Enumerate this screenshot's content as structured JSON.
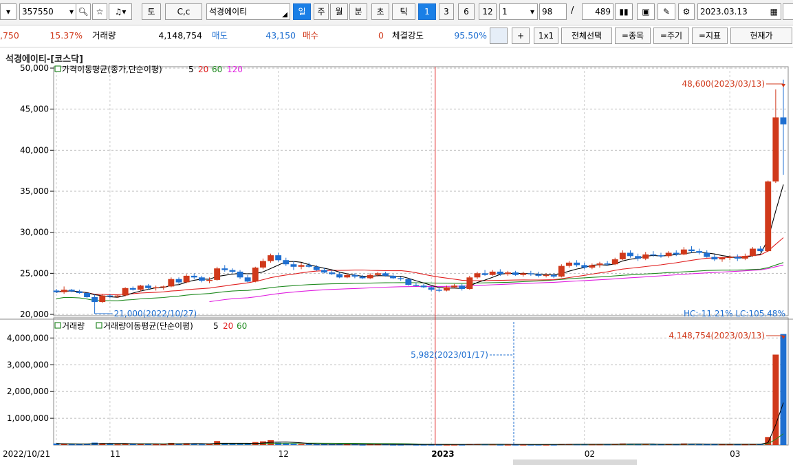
{
  "toolbar": {
    "code": "357550",
    "btn_to": "토",
    "btn_cc": "C,c",
    "stock_name": "석경에이티",
    "period_day": "일",
    "period_week": "주",
    "period_month": "월",
    "period_minute": "분",
    "period_second": "초",
    "period_tick": "틱",
    "n1": "1",
    "n3": "3",
    "n6": "6",
    "n12": "12",
    "interval_select": "1",
    "count_value": "98",
    "slash": "/",
    "total_value": "489",
    "date_value": "2023.03.13"
  },
  "infobar": {
    "change": ",750",
    "change_pct": "15.37%",
    "volume_label": "거래량",
    "volume_value": "4,148,754",
    "sell_label": "매도",
    "sell_value": "43,150",
    "buy_label": "매수",
    "buy_value": "0",
    "strength_label": "체결강도",
    "strength_value": "95.50%",
    "btn_plus": "+",
    "btn_1x1": "1x1",
    "btn_select_all": "전체선택",
    "btn_item": "=종목",
    "btn_period": "=주기",
    "btn_indicator": "=지표",
    "btn_current": "현재가"
  },
  "chart_title": "석경에이티-[코스닥]",
  "colors": {
    "up": "#d0391b",
    "down": "#1f6fd0",
    "ma5": "#000000",
    "ma20": "#e02020",
    "ma60": "#1f8a1f",
    "ma120": "#e020e0",
    "crosshair": "#e02020",
    "annot_blue": "#1f6fd0"
  },
  "chart_data": [
    {
      "type": "candlestick",
      "legend": {
        "label": "가격이동평균(종가,단순이평)",
        "periods": [
          "5",
          "20",
          "60",
          "120"
        ]
      },
      "ylim": [
        20000,
        50000
      ],
      "yticks": [
        "50,000",
        "45,000",
        "40,000",
        "35,000",
        "30,000",
        "25,000",
        "20,000"
      ],
      "ytick_values": [
        50000,
        45000,
        40000,
        35000,
        30000,
        25000,
        20000
      ],
      "annotations": {
        "high": "48,600(2023/03/13)",
        "low": "21,000(2022/10/27)",
        "hc_lc": "HC:-11.21%  LC:105.48%"
      },
      "candles": [
        [
          22900,
          23100,
          22600,
          22700
        ],
        [
          22700,
          23400,
          22500,
          23000
        ],
        [
          23000,
          23100,
          22700,
          22800
        ],
        [
          22800,
          23000,
          22500,
          22600
        ],
        [
          22600,
          22700,
          22000,
          22100
        ],
        [
          22100,
          22400,
          21000,
          21500
        ],
        [
          21500,
          22500,
          21400,
          22300
        ],
        [
          22300,
          22500,
          22000,
          22200
        ],
        [
          22200,
          22400,
          22000,
          22300
        ],
        [
          22300,
          23300,
          22200,
          23200
        ],
        [
          23200,
          23400,
          22900,
          23000
        ],
        [
          23000,
          23600,
          22800,
          23500
        ],
        [
          23500,
          23700,
          23000,
          23200
        ],
        [
          23200,
          23500,
          22900,
          23300
        ],
        [
          23300,
          23500,
          23000,
          23400
        ],
        [
          23400,
          24500,
          23300,
          24300
        ],
        [
          24300,
          24500,
          23700,
          23900
        ],
        [
          23900,
          24900,
          23800,
          24700
        ],
        [
          24700,
          25000,
          24300,
          24500
        ],
        [
          24500,
          24700,
          23900,
          24100
        ],
        [
          24100,
          24500,
          23800,
          24200
        ],
        [
          24200,
          25800,
          24100,
          25600
        ],
        [
          25600,
          26000,
          25200,
          25400
        ],
        [
          25400,
          25600,
          25000,
          25200
        ],
        [
          25200,
          25400,
          24300,
          24500
        ],
        [
          24500,
          24800,
          23900,
          24000
        ],
        [
          24000,
          25800,
          23900,
          25700
        ],
        [
          25700,
          26800,
          25500,
          26500
        ],
        [
          26500,
          27400,
          26300,
          27200
        ],
        [
          27200,
          27500,
          26400,
          26600
        ],
        [
          26600,
          26900,
          25900,
          26100
        ],
        [
          26100,
          26500,
          25400,
          25800
        ],
        [
          25800,
          26300,
          25500,
          26000
        ],
        [
          26000,
          26300,
          25700,
          25800
        ],
        [
          25800,
          26000,
          25300,
          25400
        ],
        [
          25400,
          25700,
          25000,
          25100
        ],
        [
          25100,
          25400,
          24800,
          24900
        ],
        [
          24900,
          25100,
          24400,
          24500
        ],
        [
          24500,
          25000,
          24400,
          24800
        ],
        [
          24800,
          25000,
          24400,
          24600
        ],
        [
          24600,
          24800,
          24300,
          24400
        ],
        [
          24400,
          25000,
          24300,
          24800
        ],
        [
          24800,
          25200,
          24600,
          25000
        ],
        [
          25000,
          25200,
          24600,
          24700
        ],
        [
          24700,
          24900,
          24300,
          24400
        ],
        [
          24400,
          24600,
          24100,
          24300
        ],
        [
          24300,
          24400,
          23500,
          23600
        ],
        [
          23600,
          23900,
          23400,
          23500
        ],
        [
          23500,
          23700,
          23200,
          23300
        ],
        [
          23300,
          23400,
          22800,
          23000
        ],
        [
          23000,
          23200,
          22700,
          22900
        ],
        [
          22900,
          23500,
          22800,
          23300
        ],
        [
          23300,
          23700,
          23200,
          23500
        ],
        [
          23500,
          23700,
          22900,
          23100
        ],
        [
          23100,
          24700,
          23000,
          24500
        ],
        [
          24500,
          25200,
          24300,
          25000
        ],
        [
          25000,
          25400,
          24700,
          24800
        ],
        [
          24800,
          25400,
          24700,
          25200
        ],
        [
          25200,
          25500,
          24700,
          24900
        ],
        [
          24900,
          25300,
          24700,
          25100
        ],
        [
          25100,
          25300,
          24700,
          24800
        ],
        [
          24800,
          25200,
          24600,
          25000
        ],
        [
          25000,
          25300,
          24700,
          24900
        ],
        [
          24900,
          25200,
          24500,
          24700
        ],
        [
          24700,
          25000,
          24500,
          24800
        ],
        [
          24800,
          25000,
          24400,
          24600
        ],
        [
          24600,
          26100,
          24500,
          25900
        ],
        [
          25900,
          26500,
          25700,
          26300
        ],
        [
          26300,
          26600,
          25800,
          26000
        ],
        [
          26000,
          26300,
          25500,
          25700
        ],
        [
          25700,
          26200,
          25500,
          26000
        ],
        [
          26000,
          26400,
          25700,
          26200
        ],
        [
          26200,
          26500,
          25900,
          26100
        ],
        [
          26100,
          26900,
          26000,
          26700
        ],
        [
          26700,
          27800,
          26600,
          27500
        ],
        [
          27500,
          27800,
          26900,
          27100
        ],
        [
          27100,
          27400,
          26500,
          26800
        ],
        [
          26800,
          27600,
          26600,
          27300
        ],
        [
          27300,
          27700,
          27000,
          27200
        ],
        [
          27200,
          27500,
          26900,
          27100
        ],
        [
          27100,
          27700,
          26900,
          27500
        ],
        [
          27500,
          27800,
          27100,
          27300
        ],
        [
          27300,
          28200,
          27200,
          27900
        ],
        [
          27900,
          28300,
          27500,
          27700
        ],
        [
          27700,
          28000,
          27300,
          27500
        ],
        [
          27500,
          27800,
          26900,
          27000
        ],
        [
          27000,
          27300,
          26500,
          26700
        ],
        [
          26700,
          27000,
          26400,
          26900
        ],
        [
          26900,
          27200,
          26600,
          27000
        ],
        [
          27000,
          27300,
          26500,
          26800
        ],
        [
          26800,
          27400,
          26600,
          27100
        ],
        [
          27100,
          28200,
          27000,
          28000
        ],
        [
          28000,
          28300,
          27600,
          27700
        ],
        [
          27700,
          36300,
          27600,
          36200
        ],
        [
          36200,
          47400,
          36000,
          44000
        ],
        [
          44000,
          48600,
          37000,
          43150
        ]
      ],
      "last_volume": "4,148,754(2023/03/13)"
    },
    {
      "type": "bar",
      "legend": {
        "label1": "거래량",
        "label2": "거래량이동평균(단순이평)",
        "periods": [
          "5",
          "20",
          "60"
        ]
      },
      "ylim": [
        0,
        4600000
      ],
      "yticks": [
        "4,000,000",
        "3,000,000",
        "2,000,000",
        "1,000,000"
      ],
      "ytick_values": [
        4000000,
        3000000,
        2000000,
        1000000
      ],
      "annotation": "5,982(2023/01/17)",
      "volumes": [
        60000,
        40000,
        30000,
        30000,
        50000,
        90000,
        70000,
        40000,
        30000,
        60000,
        40000,
        50000,
        40000,
        30000,
        30000,
        80000,
        40000,
        70000,
        50000,
        30000,
        40000,
        150000,
        70000,
        40000,
        40000,
        40000,
        110000,
        140000,
        180000,
        90000,
        60000,
        50000,
        40000,
        40000,
        30000,
        30000,
        30000,
        30000,
        30000,
        30000,
        20000,
        30000,
        30000,
        30000,
        20000,
        20000,
        30000,
        20000,
        20000,
        20000,
        20000,
        20000,
        20000,
        20000,
        40000,
        40000,
        30000,
        30000,
        20000,
        20000,
        20000,
        20000,
        20000,
        20000,
        20000,
        20000,
        40000,
        40000,
        30000,
        30000,
        30000,
        30000,
        30000,
        40000,
        60000,
        40000,
        30000,
        40000,
        30000,
        30000,
        40000,
        30000,
        60000,
        40000,
        30000,
        30000,
        30000,
        30000,
        30000,
        30000,
        30000,
        40000,
        40000,
        300000,
        3380000,
        4148754
      ]
    }
  ],
  "xaxis": {
    "labels": [
      "2022/10/21",
      "11",
      "12",
      "2023",
      "02",
      "03"
    ]
  }
}
